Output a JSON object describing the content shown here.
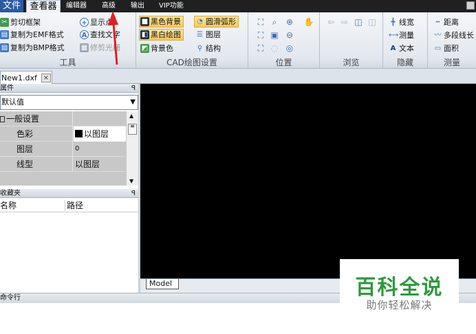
{
  "menu": {
    "file": "文件",
    "viewer": "查看器",
    "editor": "编辑器",
    "advanced": "高级",
    "output": "输出",
    "vip": "VIP功能"
  },
  "ribbon": {
    "tools": {
      "label": "工具",
      "cut_frame": "剪切框架",
      "copy_emf": "复制为EMF格式",
      "copy_bmp": "复制为BMP格式",
      "show_points": "显示点",
      "find_text": "查找文字",
      "trim_raster": "修剪光栅"
    },
    "cad": {
      "label": "CAD绘图设置",
      "black_bg": "黑色背景",
      "bw_drawing": "黑白绘图",
      "bg_color": "背景色",
      "smooth_arc": "圆滑弧形",
      "layers": "图层",
      "structure": "结构"
    },
    "position": {
      "label": "位置"
    },
    "browse": {
      "label": "浏览"
    },
    "hide": {
      "label": "隐藏",
      "line_width": "线宽",
      "measure": "测量",
      "text": "文本"
    },
    "measure": {
      "label": "测量",
      "distance": "距离",
      "polyline_length": "多段线长",
      "area": "面积"
    }
  },
  "document": {
    "tab": "New1.dxf",
    "close": "×"
  },
  "properties": {
    "title": "属件",
    "pin": "ꟼ",
    "selected": "默认值",
    "group": "一般设置",
    "rows": [
      {
        "key": "色彩",
        "value": "以图层"
      },
      {
        "key": "图层",
        "value": "0"
      },
      {
        "key": "线型",
        "value": "以图层"
      }
    ]
  },
  "favorites": {
    "title": "收藏夹",
    "pin": "ꟼ",
    "col_name": "名称",
    "col_path": "路径"
  },
  "canvas": {
    "model_tab": "Model",
    "background": "#000000"
  },
  "command": {
    "title": "命令行"
  },
  "watermark": {
    "title": "百科全说",
    "subtitle": "助你轻松解决"
  },
  "colors": {
    "accent_selected": "#f8c860",
    "annotation_arrow": "#e02020",
    "watermark_green": "#2e9a3c"
  }
}
